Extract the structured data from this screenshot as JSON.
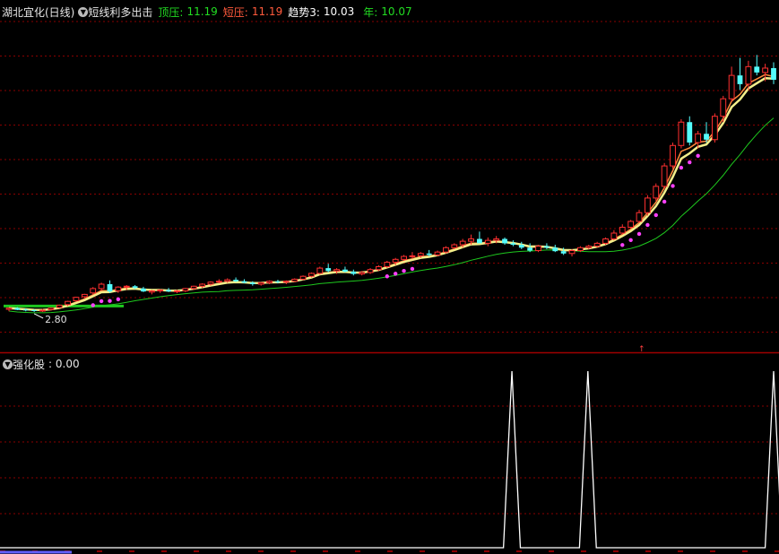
{
  "header": {
    "stock_title": "湖北宜化(日线)",
    "indicator_name": "短线利多出击",
    "items": [
      {
        "label": "顶压:",
        "value": "11.19",
        "color": "#22dd22"
      },
      {
        "label": "短压:",
        "value": "11.19",
        "color": "#ff5a3c"
      },
      {
        "label": "趋势3:",
        "value": "10.03",
        "color": "#ffffff"
      },
      {
        "label": "年:",
        "value": "10.07",
        "color": "#22dd22"
      }
    ]
  },
  "sub_header": {
    "indicator_name": "强化股",
    "value_text": ": 0.00"
  },
  "annotations": {
    "low_marker": "2.80"
  },
  "colors": {
    "up": "#ff3030",
    "down": "#54fcfc",
    "trend_line": "#f2ee8a",
    "short_line": "#ff8a3c",
    "year_line": "#1ec81e",
    "dots": "#ff40ff",
    "grid": "#8a0000",
    "separator": "#a00000",
    "signal": "#ffffff"
  },
  "chart_data": [
    {
      "type": "candlestick",
      "title": "湖北宜化(日线)",
      "ylim": [
        2.0,
        12.5
      ],
      "candles": [
        [
          2.89,
          2.95,
          2.82,
          2.93
        ],
        [
          2.93,
          2.96,
          2.86,
          2.87
        ],
        [
          2.88,
          2.92,
          2.82,
          2.85
        ],
        [
          2.86,
          2.9,
          2.8,
          2.84
        ],
        [
          2.86,
          2.9,
          2.8,
          2.86
        ],
        [
          2.88,
          2.95,
          2.85,
          2.93
        ],
        [
          2.95,
          3.05,
          2.92,
          3.03
        ],
        [
          3.05,
          3.18,
          3.0,
          3.16
        ],
        [
          3.18,
          3.32,
          3.15,
          3.3
        ],
        [
          3.32,
          3.42,
          3.25,
          3.4
        ],
        [
          3.45,
          3.65,
          3.4,
          3.6
        ],
        [
          3.6,
          3.8,
          3.52,
          3.75
        ],
        [
          3.75,
          3.88,
          3.45,
          3.5
        ],
        [
          3.52,
          3.68,
          3.45,
          3.65
        ],
        [
          3.65,
          3.72,
          3.55,
          3.68
        ],
        [
          3.68,
          3.72,
          3.58,
          3.62
        ],
        [
          3.6,
          3.66,
          3.48,
          3.5
        ],
        [
          3.48,
          3.55,
          3.4,
          3.52
        ],
        [
          3.52,
          3.58,
          3.45,
          3.55
        ],
        [
          3.55,
          3.62,
          3.48,
          3.5
        ],
        [
          3.5,
          3.56,
          3.44,
          3.52
        ],
        [
          3.52,
          3.62,
          3.48,
          3.6
        ],
        [
          3.6,
          3.7,
          3.55,
          3.68
        ],
        [
          3.68,
          3.78,
          3.62,
          3.75
        ],
        [
          3.75,
          3.85,
          3.7,
          3.82
        ],
        [
          3.82,
          3.92,
          3.78,
          3.85
        ],
        [
          3.85,
          3.95,
          3.8,
          3.9
        ],
        [
          3.9,
          3.98,
          3.82,
          3.85
        ],
        [
          3.85,
          3.92,
          3.78,
          3.8
        ],
        [
          3.8,
          3.85,
          3.7,
          3.75
        ],
        [
          3.75,
          3.82,
          3.7,
          3.8
        ],
        [
          3.8,
          3.88,
          3.75,
          3.85
        ],
        [
          3.85,
          3.9,
          3.78,
          3.82
        ],
        [
          3.82,
          3.88,
          3.75,
          3.85
        ],
        [
          3.85,
          3.95,
          3.82,
          3.92
        ],
        [
          3.92,
          4.05,
          3.88,
          4.02
        ],
        [
          4.02,
          4.15,
          3.98,
          4.12
        ],
        [
          4.12,
          4.35,
          4.08,
          4.3
        ],
        [
          4.3,
          4.45,
          4.15,
          4.2
        ],
        [
          4.2,
          4.3,
          4.1,
          4.25
        ],
        [
          4.25,
          4.35,
          4.15,
          4.18
        ],
        [
          4.18,
          4.25,
          4.05,
          4.1
        ],
        [
          4.1,
          4.2,
          4.05,
          4.15
        ],
        [
          4.15,
          4.3,
          4.1,
          4.25
        ],
        [
          4.25,
          4.4,
          4.2,
          4.35
        ],
        [
          4.35,
          4.55,
          4.3,
          4.5
        ],
        [
          4.5,
          4.65,
          4.4,
          4.6
        ],
        [
          4.6,
          4.75,
          4.55,
          4.7
        ],
        [
          4.7,
          4.85,
          4.62,
          4.72
        ],
        [
          4.72,
          4.85,
          4.65,
          4.8
        ],
        [
          4.8,
          4.92,
          4.7,
          4.75
        ],
        [
          4.75,
          4.9,
          4.7,
          4.85
        ],
        [
          4.85,
          5.05,
          4.8,
          5.0
        ],
        [
          5.0,
          5.15,
          4.95,
          5.1
        ],
        [
          5.1,
          5.3,
          5.0,
          5.22
        ],
        [
          5.22,
          5.45,
          5.1,
          5.3
        ],
        [
          5.3,
          5.55,
          5.2,
          5.15
        ],
        [
          5.15,
          5.35,
          5.05,
          5.25
        ],
        [
          5.25,
          5.4,
          5.15,
          5.3
        ],
        [
          5.3,
          5.35,
          5.1,
          5.15
        ],
        [
          5.15,
          5.25,
          5.05,
          5.1
        ],
        [
          5.1,
          5.2,
          4.95,
          5.0
        ],
        [
          5.0,
          5.15,
          4.85,
          4.9
        ],
        [
          4.9,
          5.1,
          4.85,
          5.05
        ],
        [
          5.05,
          5.15,
          4.95,
          5.0
        ],
        [
          5.0,
          5.1,
          4.85,
          4.88
        ],
        [
          4.88,
          5.0,
          4.75,
          4.8
        ],
        [
          4.8,
          4.95,
          4.7,
          4.9
        ],
        [
          4.9,
          5.05,
          4.85,
          5.0
        ],
        [
          5.0,
          5.1,
          4.95,
          5.05
        ],
        [
          5.05,
          5.2,
          5.0,
          5.15
        ],
        [
          5.15,
          5.35,
          5.1,
          5.3
        ],
        [
          5.3,
          5.6,
          5.25,
          5.5
        ],
        [
          5.5,
          5.8,
          5.45,
          5.7
        ],
        [
          5.7,
          5.95,
          5.65,
          5.9
        ],
        [
          5.9,
          6.3,
          5.85,
          6.2
        ],
        [
          6.2,
          6.8,
          6.1,
          6.7
        ],
        [
          6.7,
          7.2,
          6.6,
          7.1
        ],
        [
          7.1,
          7.9,
          7.0,
          7.8
        ],
        [
          7.8,
          8.6,
          7.7,
          8.5
        ],
        [
          8.5,
          9.4,
          8.4,
          9.3
        ],
        [
          9.3,
          9.5,
          8.5,
          8.6
        ],
        [
          8.6,
          9.0,
          8.4,
          8.9
        ],
        [
          8.9,
          9.3,
          8.6,
          8.7
        ],
        [
          8.7,
          9.6,
          8.6,
          9.5
        ],
        [
          9.5,
          10.2,
          9.3,
          10.1
        ],
        [
          10.1,
          11.2,
          10.0,
          10.9
        ],
        [
          10.9,
          11.5,
          10.4,
          10.6
        ],
        [
          10.6,
          11.4,
          10.4,
          11.2
        ],
        [
          11.2,
          11.6,
          10.9,
          11.0
        ],
        [
          11.0,
          11.3,
          10.7,
          11.15
        ],
        [
          11.15,
          11.35,
          10.6,
          10.75
        ]
      ]
    },
    {
      "type": "line",
      "title": "强化股",
      "ylim": [
        0,
        1
      ],
      "x_count": 92,
      "signals": [
        61,
        70,
        92
      ]
    }
  ]
}
